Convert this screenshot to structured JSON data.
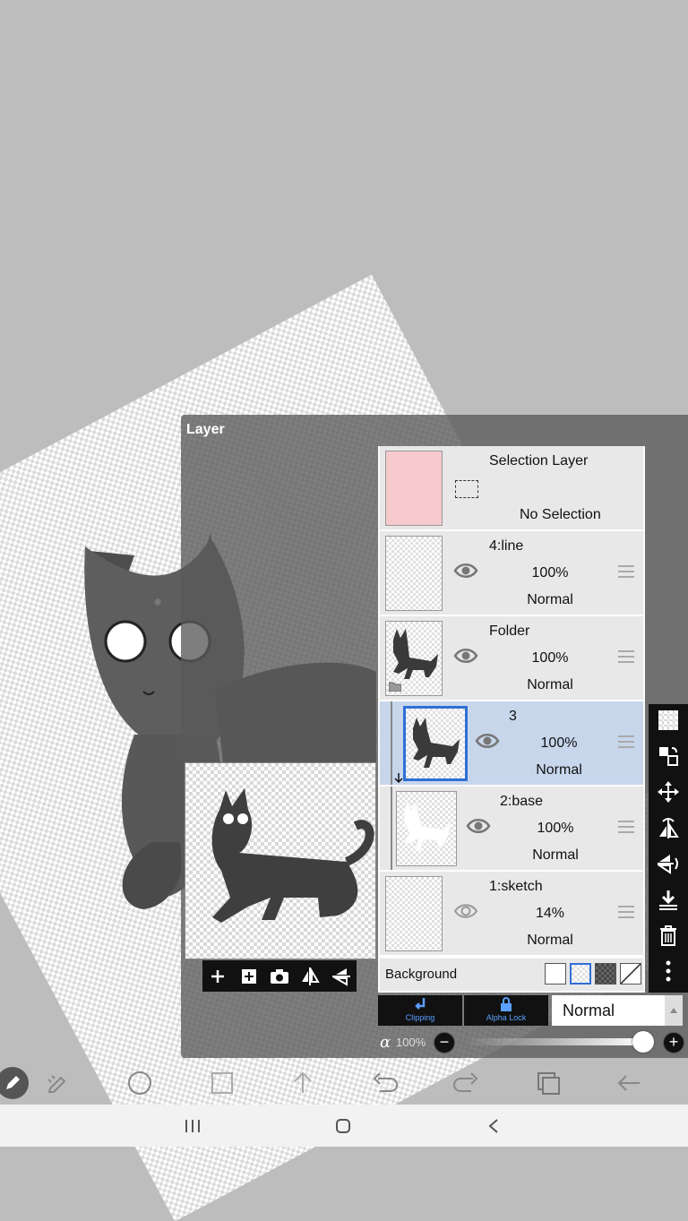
{
  "panel": {
    "title": "Layer"
  },
  "layers": [
    {
      "name": "Selection Layer",
      "status": "No Selection",
      "selected": false
    },
    {
      "name": "4:line",
      "opacity": "100%",
      "mode": "Normal",
      "selected": false
    },
    {
      "name": "Folder",
      "opacity": "100%",
      "mode": "Normal",
      "selected": false
    },
    {
      "name": "3",
      "opacity": "100%",
      "mode": "Normal",
      "selected": true
    },
    {
      "name": "2:base",
      "opacity": "100%",
      "mode": "Normal",
      "selected": false
    },
    {
      "name": "1:sketch",
      "opacity": "14%",
      "mode": "Normal",
      "selected": false
    }
  ],
  "background": {
    "label": "Background"
  },
  "controls": {
    "clipping_label": "Clipping",
    "alpha_lock_label": "Alpha Lock",
    "blend_mode": "Normal",
    "alpha_symbol": "α",
    "alpha_value": "100%",
    "alpha_fraction": 1.0
  },
  "colors": {
    "selected_row": "#c8d6ec",
    "accent": "#2f6fd6",
    "selection_thumb": "#f6c9cd"
  }
}
